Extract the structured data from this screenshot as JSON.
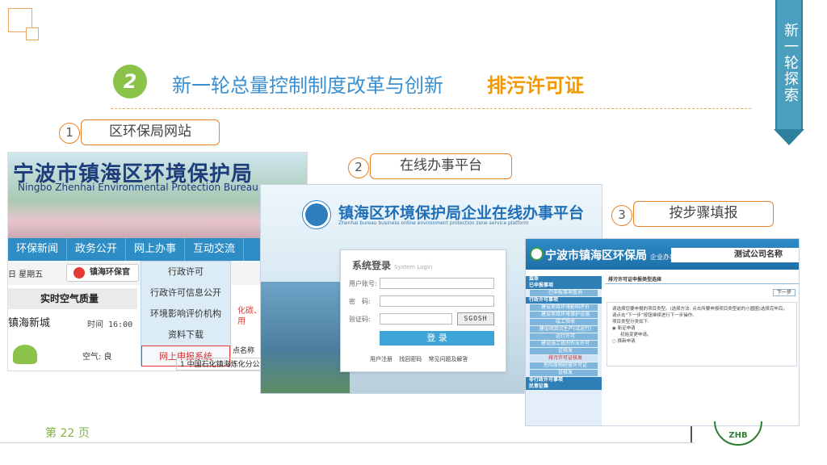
{
  "ribbon_text": "新一轮探索",
  "section_number": "2",
  "title": "新一轮总量控制制度改革与创新",
  "title_accent": "排污许可证",
  "steps": [
    {
      "num": "1",
      "label": "区环保局网站"
    },
    {
      "num": "2",
      "label": "在线办事平台"
    },
    {
      "num": "3",
      "label": "按步骤填报"
    }
  ],
  "site1": {
    "title": "宁波市镇海区环境保护局",
    "subtitle": "Ningbo Zhenhai Environmental Protection Bureau",
    "nav": [
      "环保新闻",
      "政务公开",
      "网上办事",
      "互动交流"
    ],
    "date": "日 星期五",
    "weibo": "镇海环保官",
    "air_quality": "实时空气质量",
    "location": "镇海新城",
    "time": "时间 16:00",
    "air_label": "空气: 良",
    "menu": [
      "行政许可",
      "行政许可信息公开",
      "环境影响评价机构",
      "资料下载",
      "网上申报系统"
    ],
    "red_text": "化碳、烟\n示，请启用",
    "table_header": "点名称",
    "table_row_num": "1",
    "table_row": "中国石化镇海炼化分公"
  },
  "site2": {
    "title": "镇海区环境保护局企业在线办事平台",
    "subtitle": "Zhenhai bureau business online environment protection zone service platform",
    "login_title": "系统登录",
    "login_title_en": "System Login",
    "user_label": "用户账号:",
    "pwd_label": "密　码:",
    "code_label": "验证码:",
    "captcha": "SGOSH",
    "login_button": "登 录",
    "links": "用户注册  找回密码  常见问题及解答"
  },
  "site3": {
    "title": "宁波市镇海区环保局",
    "title_sub": "企业办事平台",
    "company": "测试公司名称",
    "side": [
      {
        "type": "h",
        "text": "菜单"
      },
      {
        "type": "h",
        "text": "已申报事项"
      },
      {
        "type": "i",
        "text": "已申报事项查询"
      },
      {
        "type": "h",
        "text": "行政许可事项"
      },
      {
        "type": "i",
        "text": "建设项目环境影响评价"
      },
      {
        "type": "i",
        "text": "建设项目环境保护设施"
      },
      {
        "type": "i",
        "text": "竣工验收"
      },
      {
        "type": "i",
        "text": "建设项目试生产(试运行)"
      },
      {
        "type": "i",
        "text": "运行许可"
      },
      {
        "type": "i",
        "text": "建设施工夜间作业许可"
      },
      {
        "type": "i",
        "text": "证核发"
      },
      {
        "type": "a",
        "text": "排污许可证核发"
      },
      {
        "type": "i",
        "text": "危险废物经营许可证"
      },
      {
        "type": "i",
        "text": "证核发"
      },
      {
        "type": "h",
        "text": "非行政许可事项"
      },
      {
        "type": "h",
        "text": "民意征集"
      }
    ],
    "main_title": "排污许可证申报类型选择",
    "next": "下一步",
    "body_text": "请选择您要申报的项目类型。(选择方法: 点击所要申报项目类型前的小圆圈)选择完毕后，请点击“下一步”按钮继续进行下一步操作。",
    "body_sub": "项目类型分类如下:",
    "option1": "新证申请",
    "option1_sub": "初始变更申请。",
    "option2": "换新申请"
  },
  "page_label": "第 22 页",
  "seal_text": "ZHB"
}
